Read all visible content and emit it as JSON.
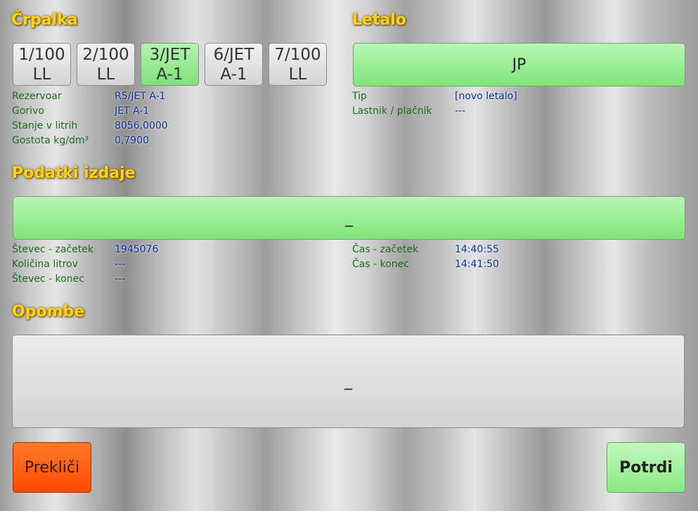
{
  "crpalka": {
    "title": "Črpalka",
    "pumps": [
      {
        "line1": "1/100",
        "line2": "LL",
        "active": false
      },
      {
        "line1": "2/100",
        "line2": "LL",
        "active": false
      },
      {
        "line1": "3/JET",
        "line2": "A-1",
        "active": true
      },
      {
        "line1": "6/JET",
        "line2": "A-1",
        "active": false
      },
      {
        "line1": "7/100",
        "line2": "LL",
        "active": false
      }
    ],
    "rows": [
      {
        "label": "Rezervoar",
        "value": "R5/JET A-1"
      },
      {
        "label": "Gorivo",
        "value": "JET A-1"
      },
      {
        "label": "Stanje v litrih",
        "value": "8056,0000"
      },
      {
        "label": "Gostota kg/dm³",
        "value": "0,7900"
      }
    ]
  },
  "letalo": {
    "title": "Letalo",
    "registration": "JP",
    "rows": [
      {
        "label": "Tip",
        "value": "[novo letalo]"
      },
      {
        "label": "Lastnik / plačnik",
        "value": "---"
      }
    ]
  },
  "izdaja": {
    "title": "Podatki izdaje",
    "input_value": "_",
    "left_rows": [
      {
        "label": "Števec - začetek",
        "value": "1945076"
      },
      {
        "label": "Količina litrov",
        "value": "---"
      },
      {
        "label": "Števec - konec",
        "value": "---"
      }
    ],
    "right_rows": [
      {
        "label": "Čas - začetek",
        "value": "14:40:55"
      },
      {
        "label": "Čas - konec",
        "value": "14:41:50"
      }
    ]
  },
  "opombe": {
    "title": "Opombe",
    "input_value": "_"
  },
  "actions": {
    "cancel_label": "Prekliči",
    "confirm_label": "Potrdi"
  },
  "colors": {
    "title": "#ffd21a",
    "active_green": "#7fe07a",
    "cancel_orange": "#ff4a00",
    "label_green": "#1d6b1d",
    "value_blue": "#0b2e9a"
  }
}
